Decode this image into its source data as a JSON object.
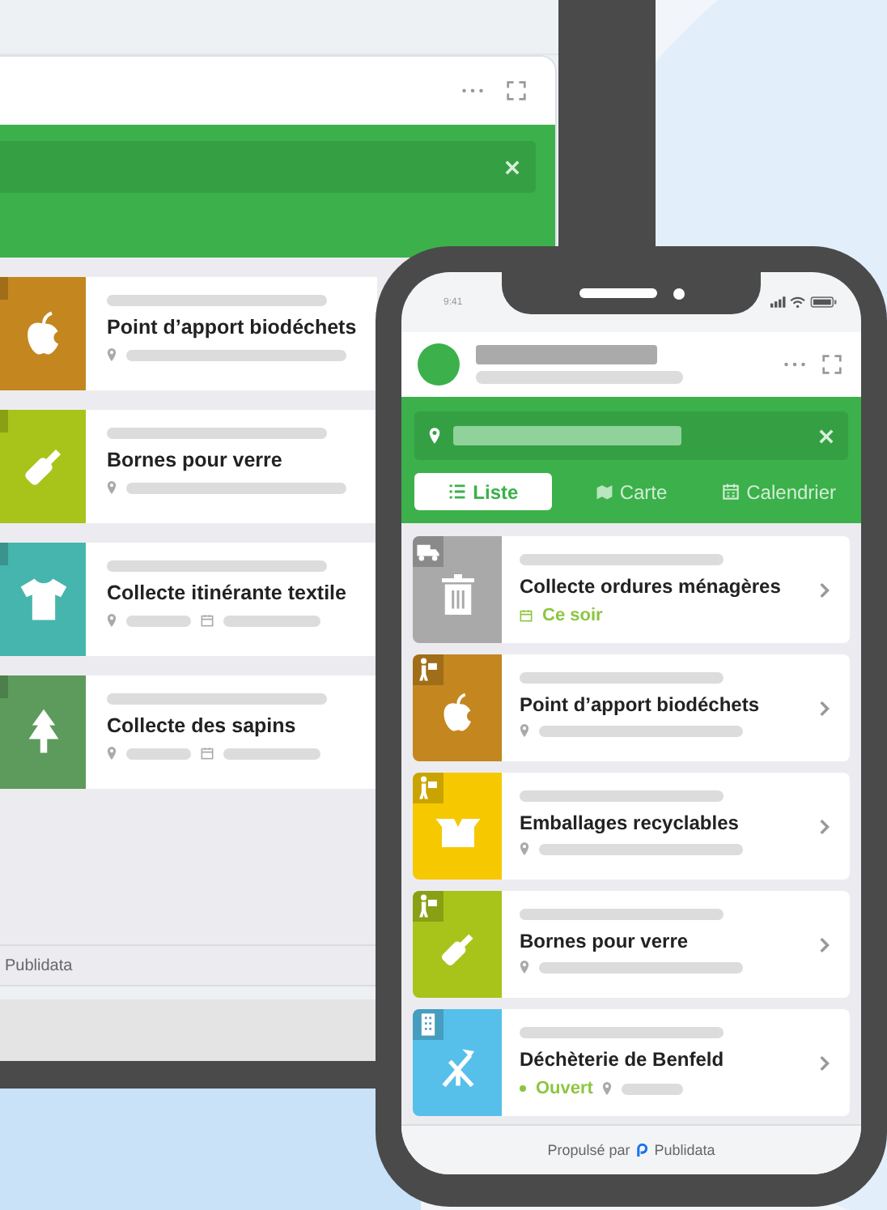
{
  "tablet": {
    "items": [
      {
        "title": "Point d’apport biodéchets",
        "kind": "apple",
        "color": "#c4861f",
        "dated": false
      },
      {
        "title": "Bornes pour verre",
        "kind": "bottle",
        "color": "#a8c41a",
        "dated": false
      },
      {
        "title": "Collecte itinérante textile",
        "kind": "shirt",
        "color": "#46b5ad",
        "dated": true
      },
      {
        "title": "Collecte des sapins",
        "kind": "tree",
        "color": "#5d9b5c",
        "dated": true
      }
    ],
    "footer": "Publidata"
  },
  "phone": {
    "status_time": "9:41",
    "tabs": [
      {
        "label": "Liste",
        "kind": "list",
        "selected": true
      },
      {
        "label": "Carte",
        "kind": "map",
        "selected": false
      },
      {
        "label": "Calendrier",
        "kind": "calendar",
        "selected": false
      }
    ],
    "items": [
      {
        "title": "Collecte ordures ménagères",
        "kind": "trash",
        "color": "#a9a9a9",
        "schedule": "Ce soir"
      },
      {
        "title": "Point d’apport biodéchets",
        "kind": "apple",
        "color": "#c4861f"
      },
      {
        "title": "Emballages recyclables",
        "kind": "box",
        "color": "#f6c800"
      },
      {
        "title": "Bornes pour verre",
        "kind": "bottle",
        "color": "#a8c41a"
      },
      {
        "title": "Déchèterie de Benfeld",
        "kind": "tools",
        "color": "#56c0ea",
        "status": "Ouvert"
      }
    ],
    "footer": {
      "prefix": "Propulsé par",
      "brand": "Publidata"
    }
  }
}
